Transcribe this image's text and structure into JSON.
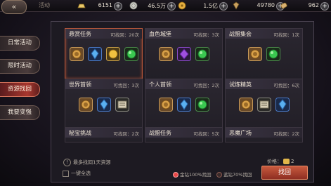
{
  "header": {
    "back_glyph": "«",
    "title": "活动",
    "resources": [
      {
        "icon": "gold-ingot-icon",
        "value": "6151",
        "color": "#e8c868"
      },
      {
        "icon": "silver-coin-icon",
        "value": "46.5万",
        "color": "#d8d8d0"
      },
      {
        "icon": "gold-coin-icon",
        "value": "1.5亿",
        "color": "#e6b040"
      },
      {
        "icon": "gem-icon",
        "value": "49780",
        "color": "#c8a060"
      },
      {
        "icon": "scroll-icon",
        "value": "962",
        "color": "#d8b070"
      }
    ],
    "plus": "+"
  },
  "nav": [
    {
      "label": "日常活动",
      "active": false
    },
    {
      "label": "限时活动",
      "active": false
    },
    {
      "label": "资源找回",
      "active": true
    },
    {
      "label": "我要变强",
      "active": false
    }
  ],
  "cards": [
    {
      "name": "悬赏任务",
      "count": "可找回：20次",
      "items": [
        "medal",
        "crystal",
        "gold-coin",
        "green-orb"
      ]
    },
    {
      "name": "血色城堡",
      "count": "可找回：3次",
      "items": [
        "medal",
        "purple-gem",
        "green-orb"
      ]
    },
    {
      "name": "战盟集会",
      "count": "可找回：1次",
      "items": [
        "medal",
        "green-orb"
      ]
    },
    {
      "name": "世界首领",
      "count": "可找回：3次",
      "items": [
        "medal",
        "crystal",
        "scroll"
      ]
    },
    {
      "name": "个人首领",
      "count": "可找回：2次",
      "items": [
        "medal",
        "crystal",
        "green-orb"
      ]
    },
    {
      "name": "试炼精英",
      "count": "可找回：6次",
      "items": [
        "medal",
        "scroll",
        "crystal"
      ]
    },
    {
      "name": "秘宝挑战",
      "count": "可找回：2次",
      "items": []
    },
    {
      "name": "战盟任务",
      "count": "可找回：5次",
      "items": []
    },
    {
      "name": "恶魔广场",
      "count": "可找回：2次",
      "items": []
    }
  ],
  "footer": {
    "note": "最多找回1天资源",
    "tip_glyph": "!",
    "select_all": "一键全选",
    "option_gold": "金钻100%找回",
    "option_silver": "蓝钻70%找回",
    "price_label": "价格：",
    "price_value": "2",
    "retrieve": "找回"
  }
}
